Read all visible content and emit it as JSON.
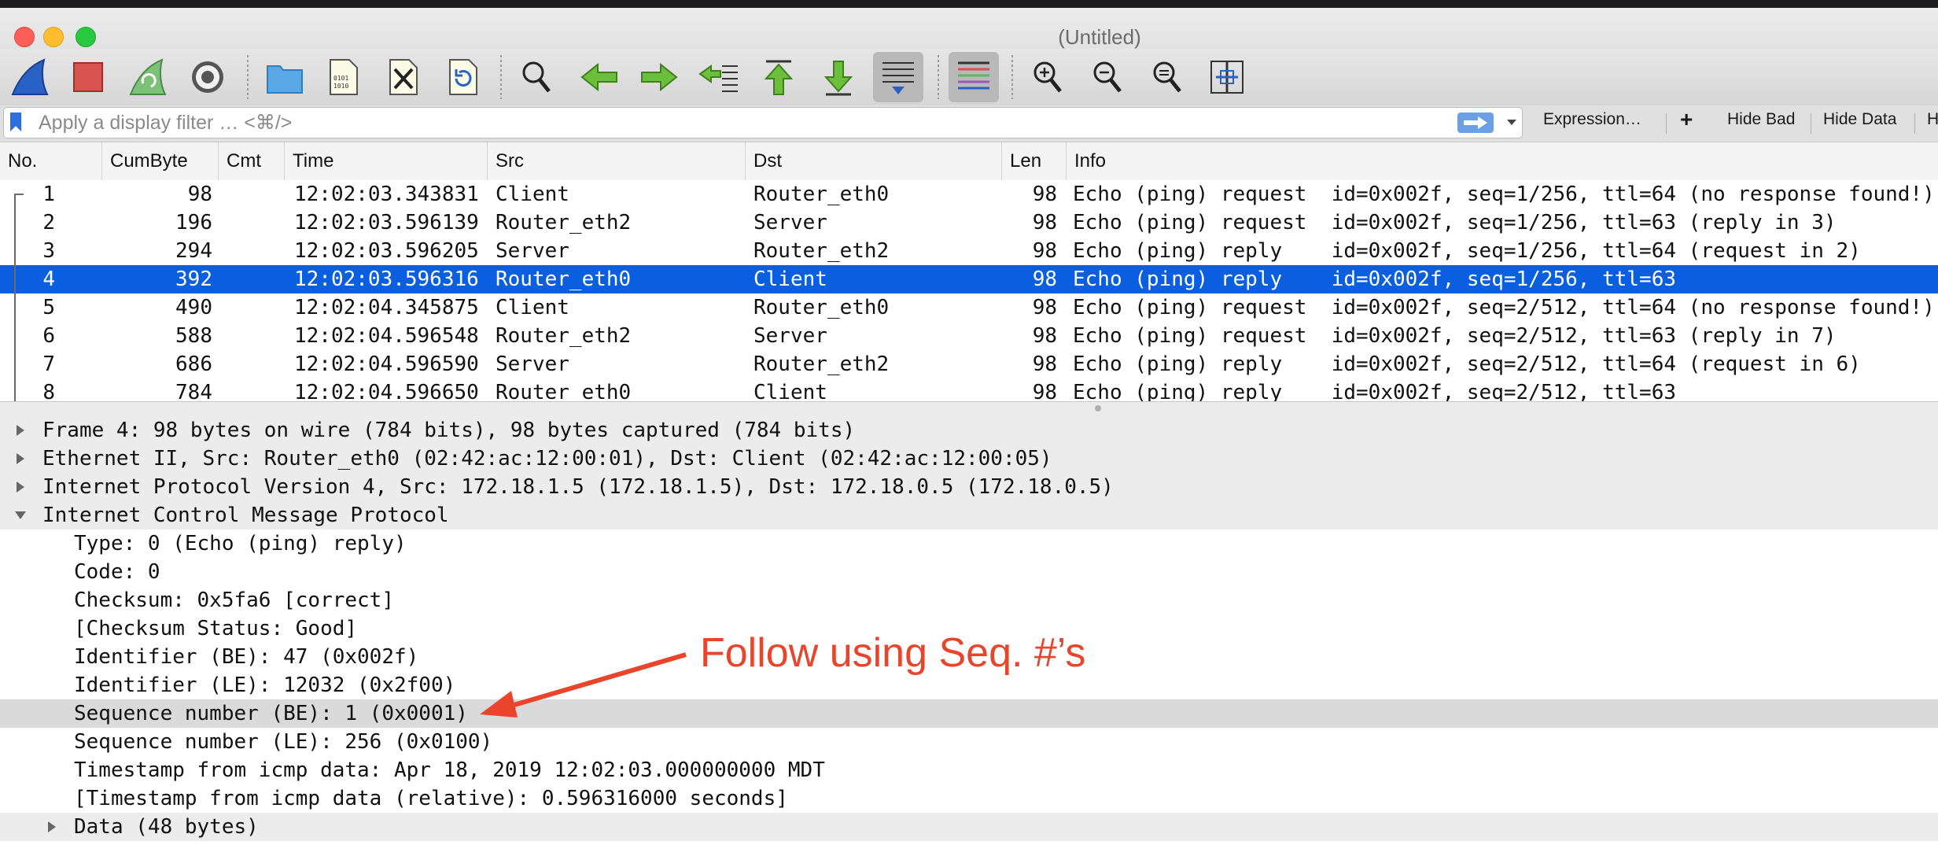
{
  "window": {
    "title": "(Untitled)"
  },
  "toolbar": {
    "buttons": [
      {
        "name": "start-capture-icon"
      },
      {
        "name": "stop-capture-icon"
      },
      {
        "name": "restart-capture-icon"
      },
      {
        "name": "capture-options-icon"
      },
      {
        "name": "open-file-icon"
      },
      {
        "name": "save-file-icon"
      },
      {
        "name": "close-file-icon"
      },
      {
        "name": "reload-file-icon"
      },
      {
        "name": "find-packet-icon"
      },
      {
        "name": "go-back-icon"
      },
      {
        "name": "go-forward-icon"
      },
      {
        "name": "go-to-packet-icon"
      },
      {
        "name": "go-first-icon"
      },
      {
        "name": "go-last-icon"
      },
      {
        "name": "autoscroll-icon"
      },
      {
        "name": "colorize-icon"
      },
      {
        "name": "zoom-in-icon"
      },
      {
        "name": "zoom-out-icon"
      },
      {
        "name": "normal-size-icon"
      },
      {
        "name": "resize-columns-icon"
      }
    ]
  },
  "filter": {
    "placeholder": "Apply a display filter … <⌘/>",
    "expression_label": "Expression…",
    "add_label": "+",
    "hide_bad_label": "Hide Bad",
    "hide_data_label": "Hide Data",
    "more_label": "H"
  },
  "columns": [
    "No.",
    "CumByte",
    "Cmt",
    "Time",
    "Src",
    "Dst",
    "Len",
    "Info"
  ],
  "packets": [
    {
      "no": "1",
      "cum": "98",
      "cmt": "",
      "time": "12:02:03.343831",
      "src": "Client",
      "dst": "Router_eth0",
      "len": "98",
      "info": "Echo (ping) request  id=0x002f, seq=1/256, ttl=64 (no response found!)"
    },
    {
      "no": "2",
      "cum": "196",
      "cmt": "",
      "time": "12:02:03.596139",
      "src": "Router_eth2",
      "dst": "Server",
      "len": "98",
      "info": "Echo (ping) request  id=0x002f, seq=1/256, ttl=63 (reply in 3)"
    },
    {
      "no": "3",
      "cum": "294",
      "cmt": "",
      "time": "12:02:03.596205",
      "src": "Server",
      "dst": "Router_eth2",
      "len": "98",
      "info": "Echo (ping) reply    id=0x002f, seq=1/256, ttl=64 (request in 2)"
    },
    {
      "no": "4",
      "cum": "392",
      "cmt": "",
      "time": "12:02:03.596316",
      "src": "Router_eth0",
      "dst": "Client",
      "len": "98",
      "info": "Echo (ping) reply    id=0x002f, seq=1/256, ttl=63"
    },
    {
      "no": "5",
      "cum": "490",
      "cmt": "",
      "time": "12:02:04.345875",
      "src": "Client",
      "dst": "Router_eth0",
      "len": "98",
      "info": "Echo (ping) request  id=0x002f, seq=2/512, ttl=64 (no response found!)"
    },
    {
      "no": "6",
      "cum": "588",
      "cmt": "",
      "time": "12:02:04.596548",
      "src": "Router_eth2",
      "dst": "Server",
      "len": "98",
      "info": "Echo (ping) request  id=0x002f, seq=2/512, ttl=63 (reply in 7)"
    },
    {
      "no": "7",
      "cum": "686",
      "cmt": "",
      "time": "12:02:04.596590",
      "src": "Server",
      "dst": "Router_eth2",
      "len": "98",
      "info": "Echo (ping) reply    id=0x002f, seq=2/512, ttl=64 (request in 6)"
    },
    {
      "no": "8",
      "cum": "784",
      "cmt": "",
      "time": "12:02:04.596650",
      "src": "Router_eth0",
      "dst": "Client",
      "len": "98",
      "info": "Echo (ping) reply    id=0x002f, seq=2/512, ttl=63"
    }
  ],
  "selected_packet": "4",
  "details": [
    {
      "text": "Frame 4: 98 bytes on wire (784 bits), 98 bytes captured (784 bits)",
      "level": 0,
      "expander": "collapsed"
    },
    {
      "text": "Ethernet II, Src: Router_eth0 (02:42:ac:12:00:01), Dst: Client (02:42:ac:12:00:05)",
      "level": 0,
      "expander": "collapsed"
    },
    {
      "text": "Internet Protocol Version 4, Src: 172.18.1.5 (172.18.1.5), Dst: 172.18.0.5 (172.18.0.5)",
      "level": 0,
      "expander": "collapsed"
    },
    {
      "text": "Internet Control Message Protocol",
      "level": 0,
      "expander": "expanded"
    },
    {
      "text": "Type: 0 (Echo (ping) reply)",
      "level": 1,
      "expander": "none"
    },
    {
      "text": "Code: 0",
      "level": 1,
      "expander": "none"
    },
    {
      "text": "Checksum: 0x5fa6 [correct]",
      "level": 1,
      "expander": "none"
    },
    {
      "text": "[Checksum Status: Good]",
      "level": 1,
      "expander": "none"
    },
    {
      "text": "Identifier (BE): 47 (0x002f)",
      "level": 1,
      "expander": "none"
    },
    {
      "text": "Identifier (LE): 12032 (0x2f00)",
      "level": 1,
      "expander": "none"
    },
    {
      "text": "Sequence number (BE): 1 (0x0001)",
      "level": 1,
      "expander": "none",
      "highlight": true
    },
    {
      "text": "Sequence number (LE): 256 (0x0100)",
      "level": 1,
      "expander": "none"
    },
    {
      "text": "Timestamp from icmp data: Apr 18, 2019 12:02:03.000000000 MDT",
      "level": 1,
      "expander": "none"
    },
    {
      "text": "[Timestamp from icmp data (relative): 0.596316000 seconds]",
      "level": 1,
      "expander": "none"
    },
    {
      "text": "Data (48 bytes)",
      "level": 1,
      "expander": "collapsed"
    }
  ],
  "annotation": {
    "text": "Follow using Seq. #’s",
    "color": "#e8452c"
  },
  "colors": {
    "selection": "#0a5fe0",
    "accent_blue": "#2a6fdb"
  }
}
